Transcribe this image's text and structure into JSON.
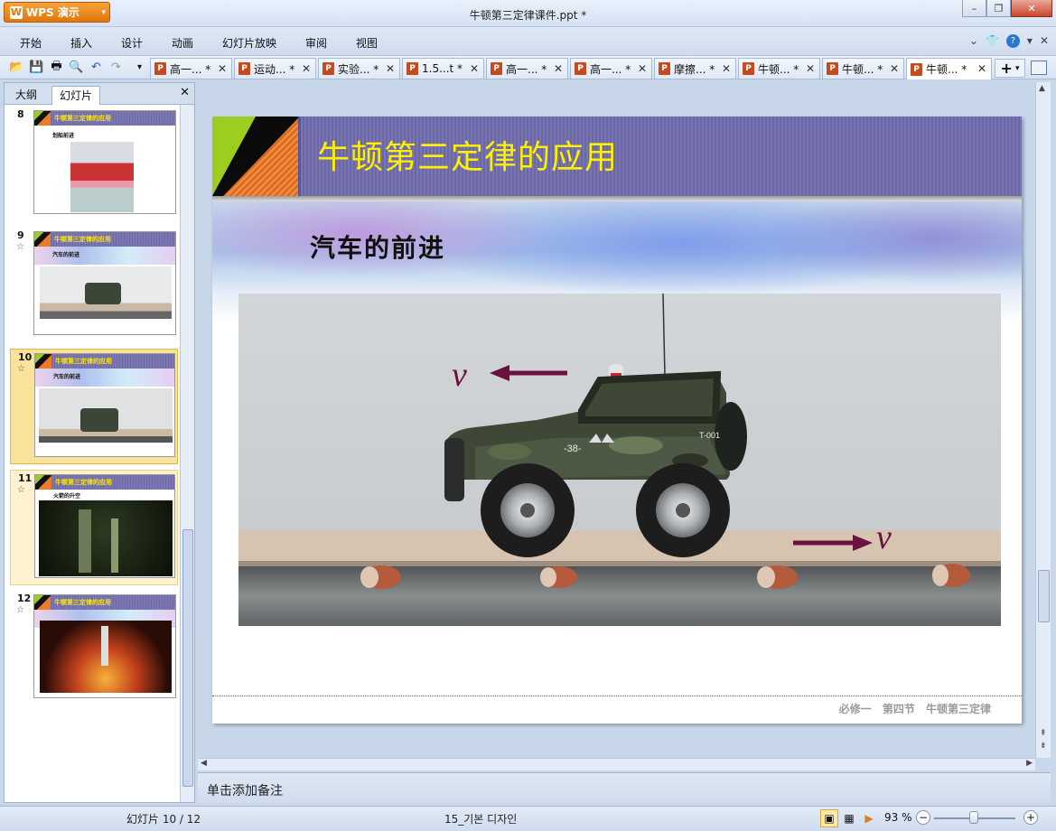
{
  "app": {
    "name": "WPS 演示",
    "doc_title": "牛顿第三定律课件.ppt *"
  },
  "menu": [
    "开始",
    "插入",
    "设计",
    "动画",
    "幻灯片放映",
    "审阅",
    "视图"
  ],
  "doc_tabs": [
    {
      "label": "高一... *"
    },
    {
      "label": "运动... *"
    },
    {
      "label": "实验... *"
    },
    {
      "label": "1.5...t *"
    },
    {
      "label": "高一... *"
    },
    {
      "label": "高一... *"
    },
    {
      "label": "摩擦... *"
    },
    {
      "label": "牛顿... *"
    },
    {
      "label": "牛顿... *"
    },
    {
      "label": "牛顿... *",
      "active": true
    }
  ],
  "panel": {
    "tab_outline": "大纲",
    "tab_slides": "幻灯片"
  },
  "thumbnails": [
    {
      "num": "8",
      "title": "牛顿第三定律的应用",
      "sub": "划船前进"
    },
    {
      "num": "9",
      "title": "牛顿第三定律的应用",
      "sub": "汽车的前进"
    },
    {
      "num": "10",
      "title": "牛顿第三定律的应用",
      "sub": "汽车的前进",
      "selected": true
    },
    {
      "num": "11",
      "title": "牛顿第三定律的应用",
      "sub": "火箭的升空"
    },
    {
      "num": "12",
      "title": "牛顿第三定律的应用",
      "sub": ""
    }
  ],
  "slide": {
    "title": "牛顿第三定律的应用",
    "subtitle": "汽车的前进",
    "v_label_top": "v",
    "v_label_bottom": "v",
    "footer": "必修一 第四节 牛顿第三定律",
    "car_plate": "T-001",
    "car_number": "-38-"
  },
  "notes_placeholder": "单击添加备注",
  "status": {
    "slide_info": "幻灯片 10 / 12",
    "theme": "15_기본 디자인",
    "zoom": "93 %"
  },
  "colors": {
    "title_yellow": "#fff000",
    "header_purple": "#7471ae",
    "arrow": "#6b1040"
  }
}
